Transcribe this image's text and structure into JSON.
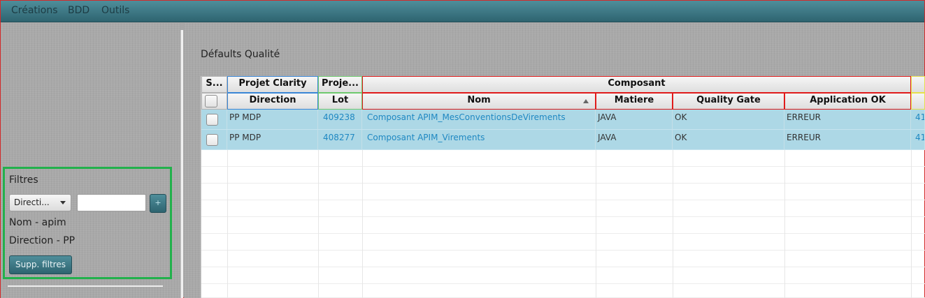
{
  "menu": {
    "items": [
      "Créations",
      "BDD",
      "Outils"
    ]
  },
  "filters": {
    "title": "Filtres",
    "select_value": "Directi...",
    "input_value": "",
    "add_label": "+",
    "active": [
      "Nom - apim",
      "Direction - PP"
    ],
    "clear_label": "Supp. filtres"
  },
  "main": {
    "title": "Défaults Qualité",
    "table": {
      "group_headers": {
        "select": "S...",
        "projet_clarity": "Projet Clarity",
        "projet": "Proje...",
        "composant": "Composant"
      },
      "columns": {
        "direction": "Direction",
        "lot": "Lot",
        "nom": "Nom",
        "matiere": "Matiere",
        "quality_gate": "Quality Gate",
        "application_ok": "Application OK"
      },
      "rows": [
        {
          "direction": "PP MDP",
          "lot": "409238",
          "nom": "Composant APIM_MesConventionsDeVirements",
          "matiere": "JAVA",
          "quality_gate": "OK",
          "application_ok": "ERREUR",
          "extra": "41"
        },
        {
          "direction": "PP MDP",
          "lot": "408277",
          "nom": "Composant APIM_Virements",
          "matiere": "JAVA",
          "quality_gate": "OK",
          "application_ok": "ERREUR",
          "extra": "41"
        }
      ]
    }
  },
  "colors": {
    "menubar": "#3e7b88",
    "filters_border": "#22b14c",
    "selected_row": "#add8e6",
    "link": "#1f88c2"
  }
}
